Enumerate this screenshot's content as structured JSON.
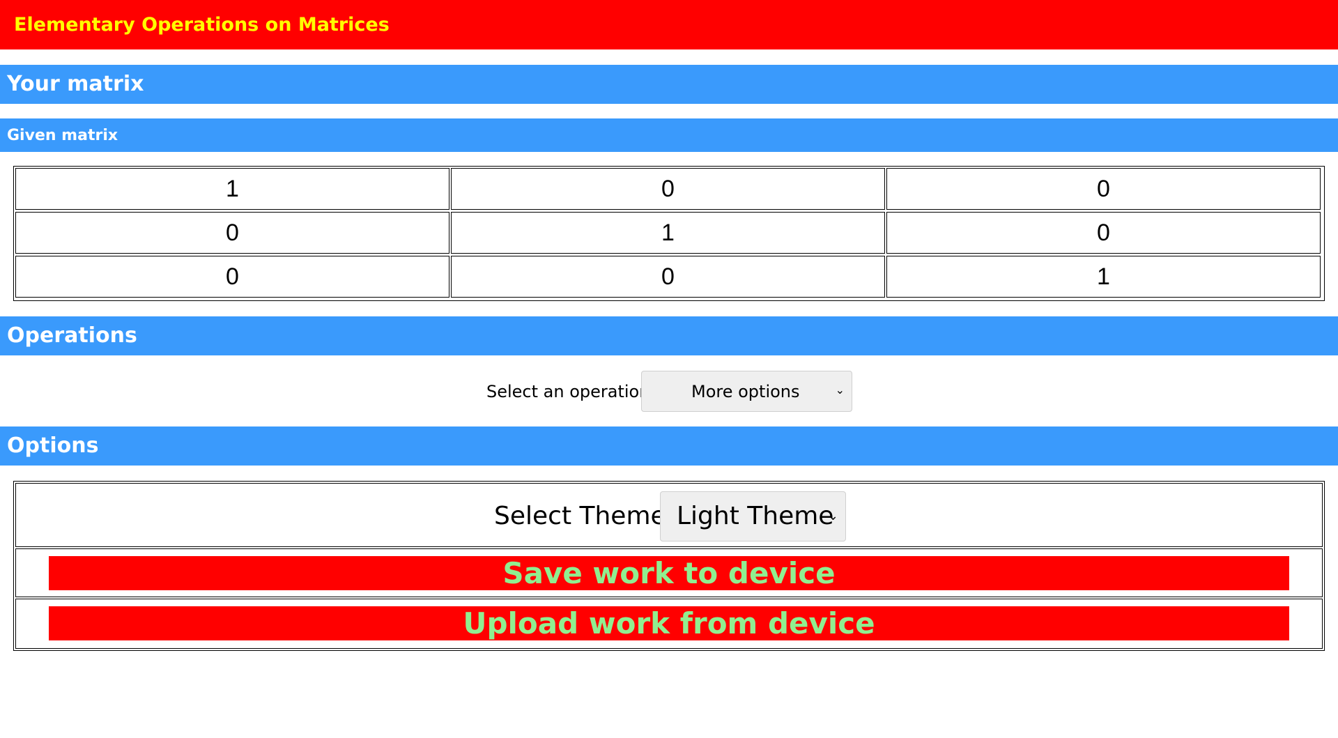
{
  "app": {
    "title": "Elementary Operations on Matrices"
  },
  "sections": {
    "your_matrix": "Your matrix",
    "given_matrix": "Given matrix",
    "operations": "Operations",
    "options": "Options"
  },
  "matrix": {
    "rows": [
      [
        "1",
        "0",
        "0"
      ],
      [
        "0",
        "1",
        "0"
      ],
      [
        "0",
        "0",
        "1"
      ]
    ]
  },
  "operations": {
    "label": "Select an operation:",
    "selected": "More options",
    "chevron_icon": "chevron-down-icon"
  },
  "options": {
    "theme_label": "Select Theme:",
    "theme_selected": "Light Theme",
    "save_label": "Save work to device",
    "upload_label": "Upload work from device"
  },
  "colors": {
    "header_bg": "#ff0000",
    "header_text": "#ffff00",
    "section_bg": "#3a9afc",
    "section_text": "#ffffff",
    "button_bg": "#ff0000",
    "button_text": "#90ee90"
  }
}
